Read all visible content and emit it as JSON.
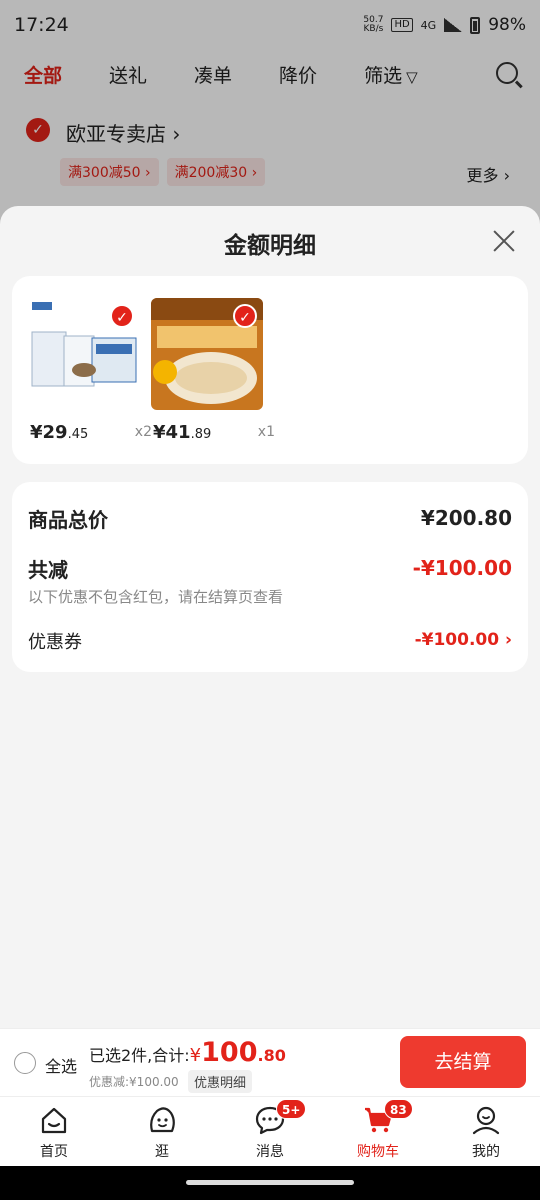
{
  "status_bar": {
    "time": "17:24",
    "net_speed_value": "50.7",
    "net_speed_unit": "KB/s",
    "hd_label": "HD",
    "net_label": "4G",
    "battery": "98%"
  },
  "filter_tabs": [
    {
      "label": "全部",
      "active": true
    },
    {
      "label": "送礼"
    },
    {
      "label": "凑单"
    },
    {
      "label": "降价"
    },
    {
      "label": "筛选"
    }
  ],
  "store": {
    "name": "欧亚专卖店 ›",
    "promos": [
      "满300减50 ›",
      "满200减30 ›"
    ],
    "more": "更多 ›"
  },
  "sheet": {
    "title": "金额明细",
    "products": [
      {
        "price_main": "¥29",
        "price_dec": ".45",
        "qty": "x2",
        "colors": [
          "#dfe9f2",
          "#3a6fb3"
        ]
      },
      {
        "price_main": "¥41",
        "price_dec": ".89",
        "qty": "x1",
        "colors": [
          "#c8761f",
          "#f1c36d"
        ]
      }
    ],
    "summary": {
      "total_label": "商品总价",
      "total_value": "¥200.80",
      "reduce_label": "共减",
      "reduce_value": "-¥100.00",
      "reduce_note": "以下优惠不包含红包，请在结算页查看",
      "coupon_label": "优惠券",
      "coupon_value": "-¥100.00 ›"
    }
  },
  "action_bar": {
    "select_all": "全选",
    "selected_text": "已选2件,合计:",
    "currency": "¥",
    "total_int": "100",
    "total_dec": ".80",
    "discount_text": "优惠减:¥100.00",
    "details_chip": "优惠明细",
    "checkout": "去结算"
  },
  "tab_bar": [
    {
      "label": "首页",
      "icon": "home-icon"
    },
    {
      "label": "逛",
      "icon": "browse-icon"
    },
    {
      "label": "消息",
      "icon": "message-icon",
      "badge": "5+"
    },
    {
      "label": "购物车",
      "icon": "cart-icon",
      "badge": "83",
      "active": true
    },
    {
      "label": "我的",
      "icon": "profile-icon"
    }
  ],
  "colors": {
    "accent": "#e2231a",
    "checkout": "#ee3a2f"
  }
}
